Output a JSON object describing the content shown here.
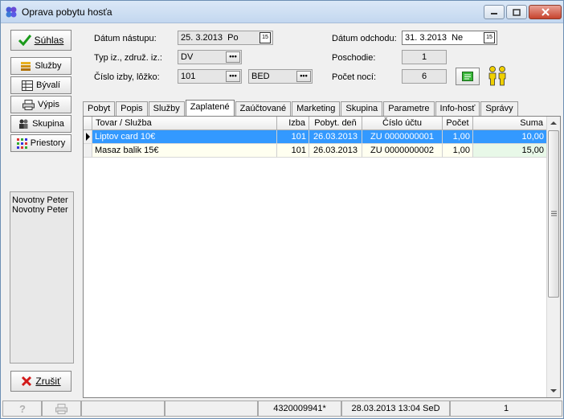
{
  "window": {
    "title": "Oprava pobytu hosťa"
  },
  "sidebar": {
    "confirm_label": "Súhlas",
    "items": [
      {
        "label": "Služby"
      },
      {
        "label": "Bývalí"
      },
      {
        "label": "Výpis"
      },
      {
        "label": "Skupina"
      },
      {
        "label": "Priestory"
      }
    ],
    "guests": [
      "Novotny Peter",
      "Novotny Peter"
    ],
    "cancel_label": "Zrušiť"
  },
  "form": {
    "arrival_label": "Dátum nástupu:",
    "arrival_value": "25. 3.2013  Po",
    "type_label": "Typ iz., združ. iz.:",
    "type_value": "DV",
    "room_label": "Číslo izby, lôžko:",
    "room_value": "101",
    "bed_value": "BED",
    "departure_label": "Dátum odchodu:",
    "departure_value": "31. 3.2013  Ne",
    "floor_label": "Poschodie:",
    "floor_value": "1",
    "nights_label": "Počet nocí:",
    "nights_value": "6",
    "ellipsis": "•••",
    "cal_text": "15"
  },
  "tabs": [
    "Pobyt",
    "Popis",
    "Služby",
    "Zaplatené",
    "Zaúčtované",
    "Marketing",
    "Skupina",
    "Parametre",
    "Info-hosť",
    "Správy"
  ],
  "active_tab": "Zaplatené",
  "table": {
    "columns": [
      "Tovar / Služba",
      "Izba",
      "Pobyt. deň",
      "Číslo účtu",
      "Počet",
      "Suma"
    ],
    "rows": [
      [
        "Liptov card 10€",
        "101",
        "26.03.2013",
        "ZU 0000000001",
        "1,00",
        "10,00"
      ],
      [
        "Masaz balik 15€",
        "101",
        "26.03.2013",
        "ZU 0000000002",
        "1,00",
        "15,00"
      ]
    ]
  },
  "status": {
    "code": "4320009941*",
    "datetime": "28.03.2013 13:04 SeD",
    "count": "1"
  },
  "colors": {
    "selected_row": "#3399ff",
    "row_bg": "#fffff0",
    "sum_bg": "#e8f8e8"
  }
}
